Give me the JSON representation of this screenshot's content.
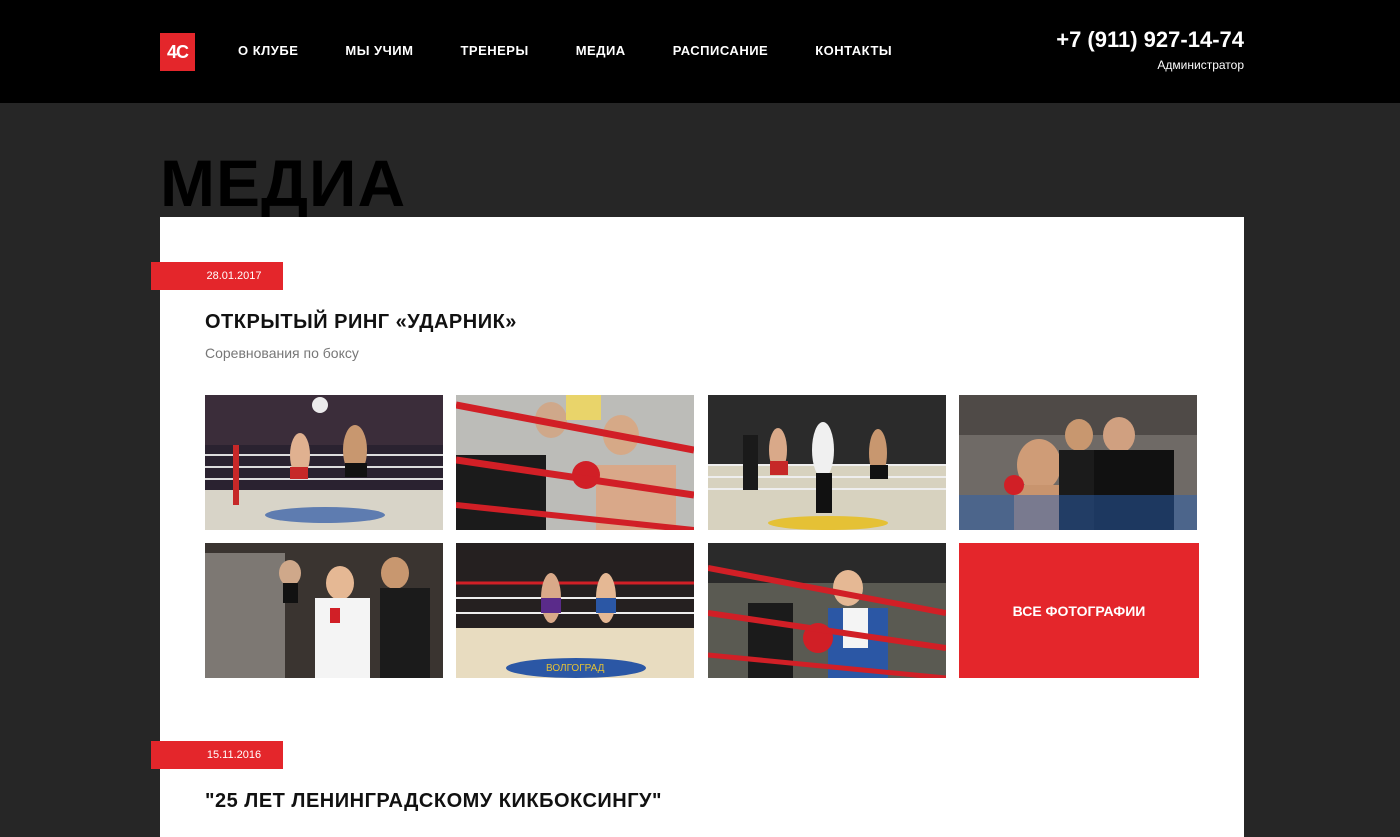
{
  "header": {
    "logo_text": "4С",
    "nav": [
      "О КЛУБЕ",
      "МЫ УЧИМ",
      "ТРЕНЕРЫ",
      "МЕДИА",
      "РАСПИСАНИЕ",
      "КОНТАКТЫ"
    ],
    "phone": "+7 (911) 927-14-74",
    "phone_label": "Администратор"
  },
  "page": {
    "title": "МЕДИА"
  },
  "events": [
    {
      "date": "28.01.2017",
      "title": "ОТКРЫТЫЙ РИНГ «УДАРНИК»",
      "subtitle": "Соревнования по боксу",
      "all_photos_label": "ВСЕ ФОТОГРАФИИ"
    },
    {
      "date": "15.11.2016",
      "title": "\"25 ЛЕТ ЛЕНИНГРАДСКОМУ КИКБОКСИНГУ\""
    }
  ],
  "colors": {
    "accent": "#e4262b",
    "header_bg": "#000000",
    "page_bg": "#262626"
  }
}
